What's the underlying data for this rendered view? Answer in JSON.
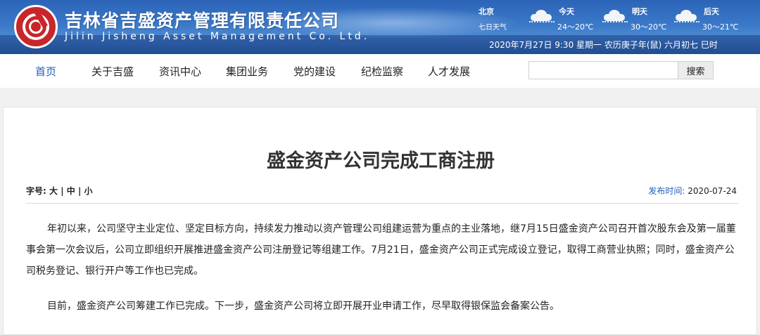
{
  "header": {
    "company_cn": "吉林省吉盛资产管理有限责任公司",
    "company_en": "Jilin Jisheng Asset Management Co. Ltd.",
    "logo_icon": "red-circular-logo",
    "weather": {
      "city": "北京",
      "subtitle": "七日天气",
      "days": [
        {
          "name": "今天",
          "temp": "24～20℃",
          "icon": "cloud-rain-icon"
        },
        {
          "name": "明天",
          "temp": "30～20℃",
          "icon": "cloud-rain-icon"
        },
        {
          "name": "后天",
          "temp": "30～21℃",
          "icon": "cloud-rain-icon"
        }
      ]
    },
    "datetime": "2020年7月27日 9:30 星期一 农历庚子年(鼠) 六月初七 巳时"
  },
  "nav": {
    "items": [
      "首页",
      "关于吉盛",
      "资讯中心",
      "集团业务",
      "党的建设",
      "纪检监察",
      "人才发展"
    ],
    "active_color": "#1f5db6",
    "search_placeholder": "",
    "search_button": "搜索"
  },
  "article": {
    "title": "盛金资产公司完成工商注册",
    "fontsize_label": "字号:",
    "fontsize_options": [
      "大",
      "中",
      "小"
    ],
    "pubdate_label": "发布时间:",
    "pubdate_value": "2020-07-24",
    "paragraphs": [
      "年初以来，公司坚守主业定位、坚定目标方向，持续发力推动以资产管理公司组建运营为重点的主业落地，继7月15日盛金资产公司召开首次股东会及第一届董事会第一次会议后，公司立即组织开展推进盛金资产公司注册登记等组建工作。7月21日，盛金资产公司正式完成设立登记，取得工商营业执照；同时，盛金资产公司税务登记、银行开户等工作也已完成。",
      "目前，盛金资产公司筹建工作已完成。下一步，盛金资产公司将立即开展开业申请工作，尽早取得银保监会备案公告。"
    ]
  }
}
